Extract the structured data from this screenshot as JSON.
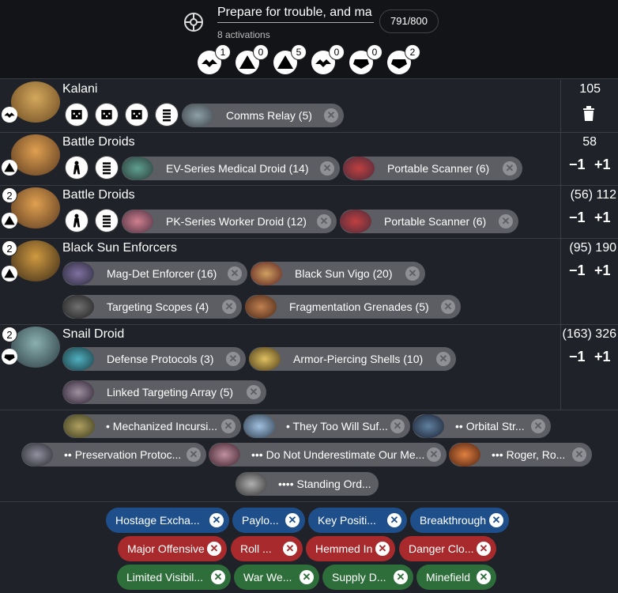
{
  "header": {
    "list_title": "Prepare for trouble, and ma",
    "activations": "8 activations",
    "points": "791/800",
    "faction_icon": "separatist-icon",
    "ranks": [
      {
        "icon": "commander-rank-icon",
        "count": "1"
      },
      {
        "icon": "operative-rank-icon",
        "count": "0"
      },
      {
        "icon": "corps-rank-icon",
        "count": "5"
      },
      {
        "icon": "special-forces-rank-icon",
        "count": "0"
      },
      {
        "icon": "support-rank-icon",
        "count": "0"
      },
      {
        "icon": "heavy-rank-icon",
        "count": "2"
      }
    ]
  },
  "units": [
    {
      "name": "Kalani",
      "points": "105",
      "rank_icon": "commander-rank-icon",
      "upgrades": [
        {
          "label": "Comms Relay (5)"
        }
      ]
    },
    {
      "name": "Battle Droids",
      "points": "58",
      "rank_icon": "corps-rank-icon",
      "upgrades": [
        {
          "label": "EV-Series Medical Droid (14)"
        },
        {
          "label": "Portable Scanner (6)"
        }
      ],
      "minus": "−1",
      "plus": "+1"
    },
    {
      "name": "Battle Droids",
      "count": "2",
      "points": "(56) 112",
      "rank_icon": "corps-rank-icon",
      "upgrades": [
        {
          "label": "PK-Series Worker Droid (12)"
        },
        {
          "label": "Portable Scanner (6)"
        }
      ],
      "minus": "−1",
      "plus": "+1"
    },
    {
      "name": "Black Sun Enforcers",
      "count": "2",
      "points": "(95) 190",
      "rank_icon": "corps-rank-icon",
      "upgrades": [
        {
          "label": "Mag-Det Enforcer (16)"
        },
        {
          "label": "Black Sun Vigo (20)"
        },
        {
          "label": "Targeting Scopes (4)"
        },
        {
          "label": "Fragmentation Grenades (5)"
        }
      ],
      "minus": "−1",
      "plus": "+1"
    },
    {
      "name": "Snail Droid",
      "count": "2",
      "points": "(163) 326",
      "rank_icon": "heavy-rank-icon",
      "upgrades": [
        {
          "label": "Defense Protocols (3)"
        },
        {
          "label": "Armor-Piercing Shells (10)"
        },
        {
          "label": "Linked Targeting Array (5)"
        }
      ],
      "minus": "−1",
      "plus": "+1"
    }
  ],
  "command_cards": [
    {
      "label": "• Mechanized Incursi..."
    },
    {
      "label": "• They Too Will Suf..."
    },
    {
      "label": "•• Orbital Str..."
    },
    {
      "label": "•• Preservation Protoc..."
    },
    {
      "label": "••• Do Not Underestimate Our Me..."
    },
    {
      "label": "••• Roger, Ro..."
    },
    {
      "label": "•••• Standing Ord..."
    }
  ],
  "objectives": [
    {
      "label": "Hostage Excha...",
      "type": "blue"
    },
    {
      "label": "Paylo...",
      "type": "blue"
    },
    {
      "label": "Key Positi...",
      "type": "blue"
    },
    {
      "label": "Breakthrough",
      "type": "blue"
    },
    {
      "label": "Major Offensive",
      "type": "red"
    },
    {
      "label": "Roll ...",
      "type": "red"
    },
    {
      "label": "Hemmed In",
      "type": "red"
    },
    {
      "label": "Danger Clo...",
      "type": "red"
    },
    {
      "label": "Limited Visibil...",
      "type": "green"
    },
    {
      "label": "War We...",
      "type": "green"
    },
    {
      "label": "Supply D...",
      "type": "green"
    },
    {
      "label": "Minefield",
      "type": "green"
    }
  ],
  "remove_glyph": "✕",
  "colors": {
    "blue": "#1e4f8a",
    "red": "#a82a2c",
    "green": "#2e6e3a",
    "chip": "#5c5e63"
  }
}
